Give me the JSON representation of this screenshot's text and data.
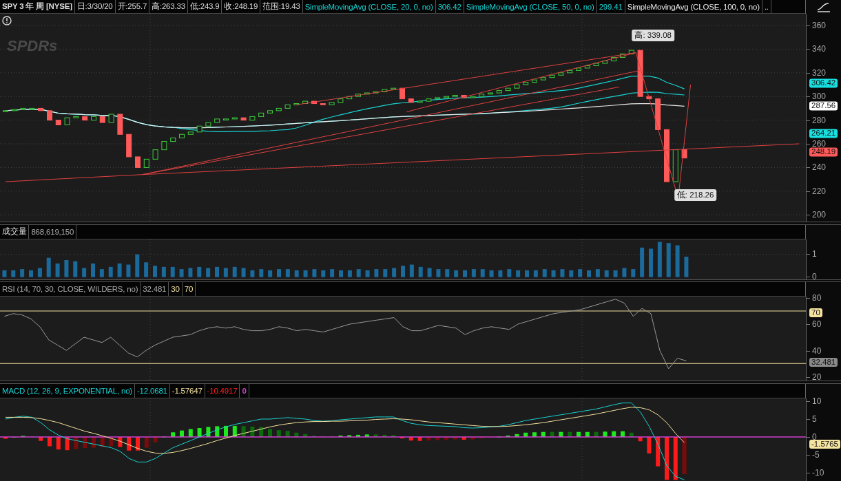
{
  "header": {
    "symbol": "SPY 3 年 周 [NYSE]",
    "fields": [
      "日:3/30/20",
      "开:255.7",
      "高:263.33",
      "低:243.9",
      "收:248.19",
      "范围:19.43"
    ],
    "studies": [
      {
        "text": "SimpleMovingAvg (CLOSE, 20, 0, no)",
        "value": "306.42",
        "color": "#19d3d3"
      },
      {
        "text": "SimpleMovingAvg (CLOSE, 50, 0, no)",
        "value": "299.41",
        "color": "#19d3d3"
      },
      {
        "text": "SimpleMovingAvg (CLOSE, 100, 0, no)",
        "color": "#e8e8e8"
      }
    ],
    "more": ".."
  },
  "price_panel": {
    "logo": "SPDRs",
    "axis_labels": [
      "360",
      "340",
      "320",
      "300",
      "280",
      "260",
      "240",
      "220",
      "200"
    ],
    "callouts": [
      "高: 339.08",
      "低: 218.26"
    ],
    "tags": [
      {
        "text": "306.42",
        "color": "#19e0e0"
      },
      {
        "text": "287.56",
        "color": "#ffffff"
      },
      {
        "text": "264.21",
        "color": "#19e0e0"
      },
      {
        "text": "248.19",
        "color": "#ff5a5a"
      }
    ]
  },
  "volume_panel": {
    "label": "成交量",
    "value": "868,619,150",
    "chart_data": {
      "type": "bar",
      "ylim": [
        -0.1,
        1.657
      ],
      "yticks": [
        0,
        1
      ],
      "grid": true,
      "values": [
        0.3,
        0.3,
        0.35,
        0.3,
        0.4,
        0.85,
        0.6,
        0.75,
        0.7,
        0.4,
        0.6,
        0.35,
        0.45,
        0.6,
        0.55,
        1.0,
        0.65,
        0.5,
        0.45,
        0.45,
        0.35,
        0.4,
        0.45,
        0.4,
        0.45,
        0.4,
        0.45,
        0.4,
        0.3,
        0.35,
        0.3,
        0.35,
        0.35,
        0.3,
        0.3,
        0.35,
        0.3,
        0.35,
        0.3,
        0.3,
        0.35,
        0.3,
        0.35,
        0.35,
        0.4,
        0.5,
        0.55,
        0.45,
        0.4,
        0.35,
        0.35,
        0.3,
        0.3,
        0.35,
        0.35,
        0.3,
        0.3,
        0.35,
        0.3,
        0.3,
        0.3,
        0.35,
        0.3,
        0.35,
        0.3,
        0.35,
        0.3,
        0.35,
        0.3,
        0.3,
        0.4,
        0.35,
        1.3,
        1.25,
        1.55,
        1.5,
        1.4,
        0.9,
        null,
        null,
        null,
        null,
        null,
        null,
        null,
        null,
        null,
        null,
        null,
        null,
        null
      ]
    }
  },
  "rsi_panel": {
    "label": "RSI (14, 70, 30, CLOSE, WILDERS, no)",
    "value": "32.481",
    "levels": [
      "30",
      "70"
    ],
    "tags": [
      {
        "text": "70",
        "color": "#f5e3a0"
      },
      {
        "text": "32.481",
        "color": "#8a8a8a"
      }
    ],
    "chart_data": {
      "type": "line",
      "ylim": [
        17,
        81
      ],
      "yticks": [
        20,
        40,
        60,
        80
      ],
      "grid": true,
      "ref_lines": [
        {
          "axis": "y",
          "value": 30
        },
        {
          "axis": "y",
          "value": 70
        }
      ],
      "series": [
        {
          "color": "#9a9a9a",
          "values": [
            66,
            68,
            67,
            64,
            58,
            48,
            44,
            40,
            45,
            50,
            48,
            46,
            50,
            44,
            38,
            35,
            40,
            44,
            47,
            50,
            51,
            52,
            55,
            57,
            58,
            57,
            58,
            56,
            55,
            55,
            56,
            58,
            57,
            55,
            56,
            55,
            54,
            56,
            58,
            60,
            61,
            62,
            63,
            64,
            65,
            58,
            55,
            55,
            57,
            59,
            58,
            57,
            52,
            55,
            57,
            58,
            57,
            56,
            60,
            62,
            64,
            66,
            68,
            69,
            70,
            71,
            73,
            75,
            77,
            79,
            76,
            66,
            72,
            68,
            40,
            26,
            34,
            32,
            null,
            null,
            null,
            null,
            null,
            null,
            null,
            null,
            null,
            null,
            null,
            null,
            null
          ]
        }
      ]
    }
  },
  "macd_panel": {
    "label": "MACD (12, 26, 9, EXPONENTIAL, no)",
    "values": [
      {
        "text": "-12.0681",
        "color": "#19d3d3"
      },
      {
        "text": "-1.57647",
        "color": "#f5e3a0"
      },
      {
        "text": "-10.4917",
        "color": "#ff2020"
      },
      {
        "text": "0",
        "color": "#d040d0"
      }
    ],
    "axis_labels": [
      "10",
      "5",
      "0",
      "-5",
      "-10"
    ],
    "tags": [
      {
        "text": "-1.5765",
        "color": "#f5e3a0"
      }
    ]
  }
}
